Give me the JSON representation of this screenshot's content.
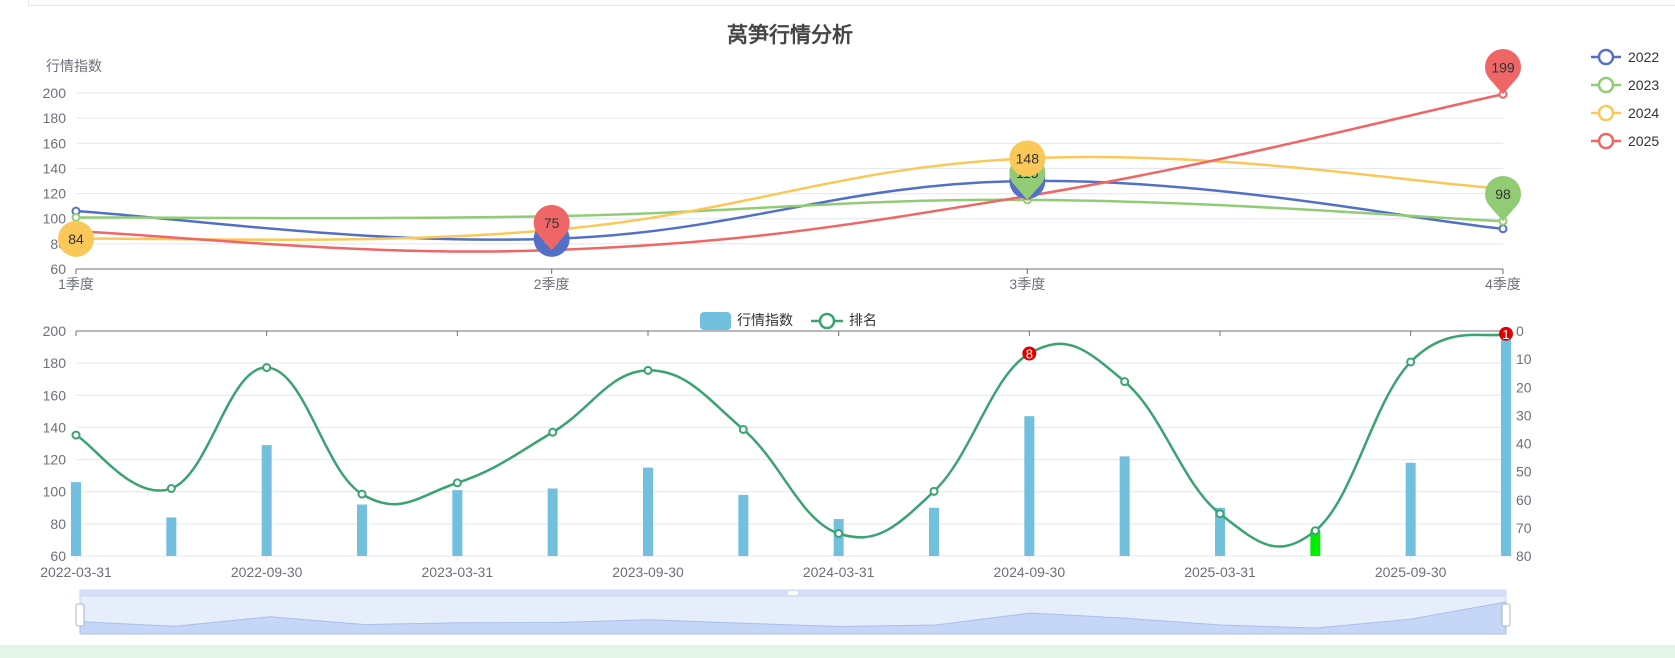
{
  "chart_data": [
    {
      "type": "line",
      "title": "莴笋行情分析",
      "ylabel": "行情指数",
      "ylim": [
        60,
        200
      ],
      "yticks": [
        60,
        80,
        100,
        120,
        140,
        160,
        180,
        200
      ],
      "categories": [
        "1季度",
        "2季度",
        "3季度",
        "4季度"
      ],
      "smooth": true,
      "legend_position": "top-right",
      "grid": true,
      "series": [
        {
          "name": "2022",
          "color": "#5470c6",
          "values": [
            106,
            84,
            130,
            92
          ],
          "markers": [
            {
              "index": 1,
              "label": "84",
              "shape": "circle"
            },
            {
              "index": 2,
              "label": "130",
              "shape": "circle"
            }
          ]
        },
        {
          "name": "2023",
          "color": "#91cc75",
          "values": [
            101,
            102,
            115,
            98
          ],
          "markers": [
            {
              "index": 2,
              "label": "115",
              "shape": "pin"
            },
            {
              "index": 3,
              "label": "98",
              "shape": "pin"
            }
          ]
        },
        {
          "name": "2024",
          "color": "#fac858",
          "values": [
            84,
            91,
            148,
            124
          ],
          "markers": [
            {
              "index": 0,
              "label": "84",
              "shape": "circle"
            },
            {
              "index": 2,
              "label": "148",
              "shape": "circle"
            }
          ]
        },
        {
          "name": "2025",
          "color": "#ee6666",
          "values": [
            90,
            75,
            118,
            199
          ],
          "markers": [
            {
              "index": 1,
              "label": "75",
              "shape": "pin"
            },
            {
              "index": 3,
              "label": "199",
              "shape": "pin"
            }
          ]
        }
      ]
    },
    {
      "type": "bar",
      "legend": [
        {
          "name": "行情指数",
          "kind": "bar",
          "color": "#73c0de"
        },
        {
          "name": "排名",
          "kind": "line",
          "color": "#3ba272"
        }
      ],
      "legend_position": "top-center",
      "x": [
        "2022-03-31",
        "2022-06-30",
        "2022-09-30",
        "2022-12-31",
        "2023-03-31",
        "2023-06-30",
        "2023-09-30",
        "2023-12-31",
        "2024-03-31",
        "2024-06-30",
        "2024-09-30",
        "2024-12-31",
        "2025-03-31",
        "2025-06-30",
        "2025-09-30",
        "2025-12-31"
      ],
      "xtick_labels": [
        "2022-03-31",
        "2022-09-30",
        "2023-03-31",
        "2023-09-30",
        "2024-03-31",
        "2024-09-30",
        "2025-03-31",
        "2025-09-30"
      ],
      "y_left": {
        "ylim": [
          60,
          200
        ],
        "ticks": [
          60,
          80,
          100,
          120,
          140,
          160,
          180,
          200
        ]
      },
      "y_right": {
        "ylim": [
          80,
          0
        ],
        "inverted": true,
        "ticks": [
          0,
          10,
          20,
          30,
          40,
          50,
          60,
          70,
          80
        ]
      },
      "bar_series": {
        "name": "行情指数",
        "color": "#73c0de",
        "highlight_color": "#00ee00",
        "highlight_index": 13,
        "values": [
          106,
          84,
          129,
          92,
          101,
          102,
          115,
          98,
          83,
          90,
          147,
          122,
          90,
          76,
          118,
          199
        ]
      },
      "line_series": {
        "name": "排名",
        "color": "#3ba272",
        "values": [
          37,
          56,
          13,
          58,
          54,
          36,
          14,
          35,
          72,
          57,
          8,
          18,
          65,
          71,
          11,
          1
        ],
        "markers": [
          {
            "index": 10,
            "label": "8"
          },
          {
            "index": 15,
            "label": "1"
          }
        ],
        "marker_color": "#e00000"
      },
      "datazoom_overview": {
        "range": [
          0,
          100
        ]
      }
    }
  ]
}
